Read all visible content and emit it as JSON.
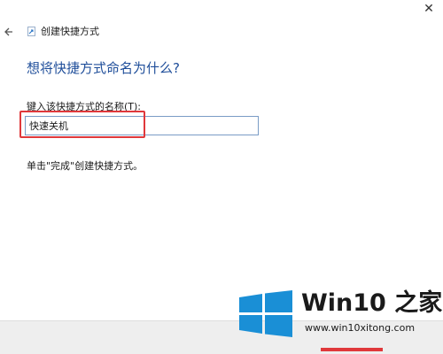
{
  "window": {
    "title": "创建快捷方式",
    "close_glyph": "✕"
  },
  "icons": {
    "back": "back-arrow-icon",
    "shortcut": "shortcut-icon",
    "close": "close-icon",
    "logo": "windows-logo-icon"
  },
  "page": {
    "heading": "想将快捷方式命名为什么?",
    "field_label": "键入该快捷方式的名称(T):",
    "name_value": "快速关机",
    "finish_hint": "单击\"完成\"创建快捷方式。"
  },
  "watermark": {
    "brand": "Win10 之家",
    "url": "www.win10xitong.com"
  },
  "colors": {
    "heading": "#1f4e9a",
    "highlight": "#e0383b",
    "logo": "#1a8fd6"
  }
}
